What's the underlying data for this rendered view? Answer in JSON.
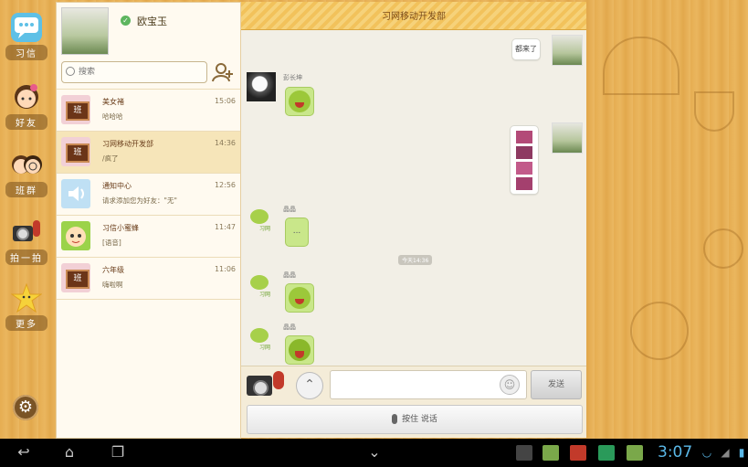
{
  "nav": {
    "items": [
      {
        "label": "习信",
        "icon": "chat-bubble-icon"
      },
      {
        "label": "好友",
        "icon": "friends-girl-icon"
      },
      {
        "label": "班群",
        "icon": "class-group-icon"
      },
      {
        "label": "拍一拍",
        "icon": "camera-icon"
      },
      {
        "label": "更多",
        "icon": "star-icon"
      }
    ],
    "settings_icon": "gear-icon"
  },
  "profile": {
    "name": "欧宝玉"
  },
  "search": {
    "placeholder": "搜索"
  },
  "conversations": [
    {
      "name": "美女褚",
      "time": "15:06",
      "message": "哈哈哈",
      "avatar": "class-board",
      "avatar_text": "班"
    },
    {
      "name": "习网移动开发部",
      "time": "14:36",
      "message": "/疯了",
      "avatar": "class-board",
      "avatar_text": "班",
      "selected": true
    },
    {
      "name": "通知中心",
      "time": "12:56",
      "message": "请求添加您为好友：\"无\"",
      "avatar": "speaker"
    },
    {
      "name": "习信小蜜蜂",
      "time": "11:47",
      "message": "[语音]",
      "avatar": "bee"
    },
    {
      "name": "六年级",
      "time": "11:06",
      "message": "嗨啦啊",
      "avatar": "class-board",
      "avatar_text": "班"
    }
  ],
  "chat": {
    "title": "习网移动开发部",
    "messages": [
      {
        "side": "right",
        "type": "text",
        "text": "都来了"
      },
      {
        "side": "left",
        "sender": "彭长坤",
        "type": "emoji"
      },
      {
        "side": "right",
        "type": "images",
        "count": 4
      },
      {
        "side": "left",
        "sender": "晶晶",
        "type": "text",
        "text": "..."
      },
      {
        "side": "left",
        "sender": "晶晶",
        "type": "emoji"
      },
      {
        "side": "left",
        "sender": "晶晶",
        "type": "emoji"
      }
    ],
    "time_divider": "今天14:36",
    "bee_label": "习网"
  },
  "composer": {
    "send_label": "发送",
    "push_to_talk": "按住 说话"
  },
  "system": {
    "clock": "3:07"
  }
}
